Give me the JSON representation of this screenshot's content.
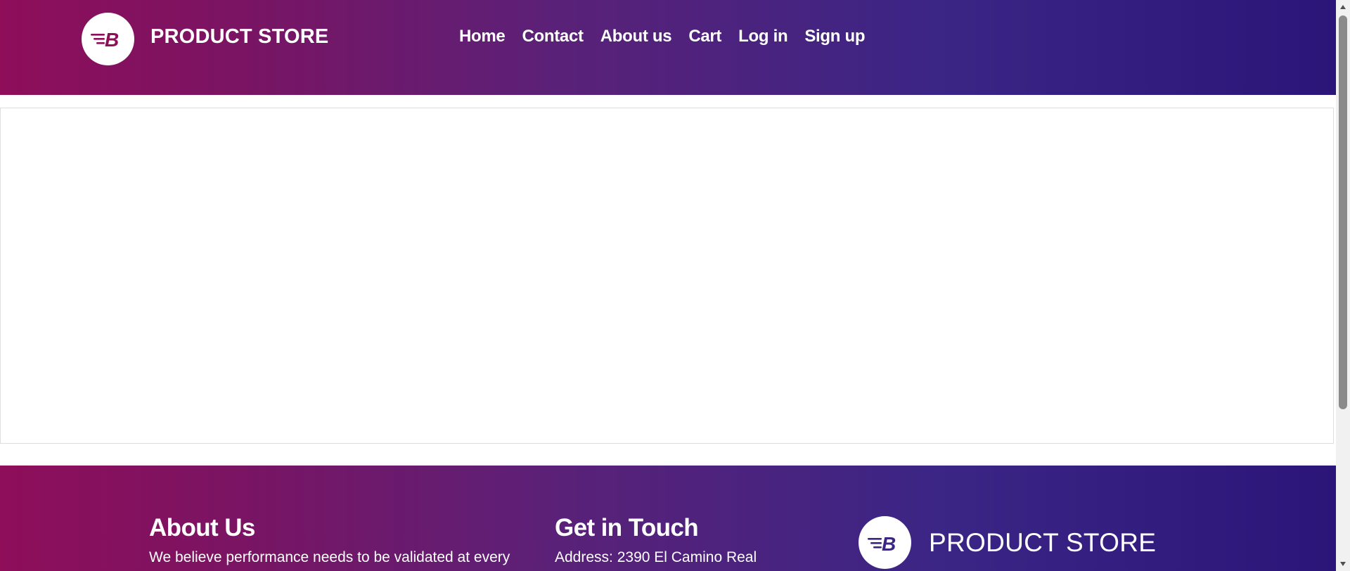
{
  "header": {
    "brand_name": "PRODUCT STORE",
    "nav": [
      {
        "label": "Home"
      },
      {
        "label": "Contact"
      },
      {
        "label": "About us"
      },
      {
        "label": "Cart"
      },
      {
        "label": "Log in"
      },
      {
        "label": "Sign up"
      }
    ]
  },
  "footer": {
    "about": {
      "heading": "About Us",
      "text": "We believe performance needs to be validated at every"
    },
    "contact": {
      "heading": "Get in Touch",
      "text": "Address: 2390 El Camino Real"
    },
    "brand_name": "PRODUCT STORE"
  },
  "icons": {
    "logo": "logo-b-icon",
    "scroll_up": "scroll-up-arrow-icon",
    "scroll_down": "scroll-down-arrow-icon"
  },
  "colors": {
    "gradient_start": "#8e0e5a",
    "gradient_end": "#2b1578",
    "logo_mark": "#8e0e5a"
  }
}
